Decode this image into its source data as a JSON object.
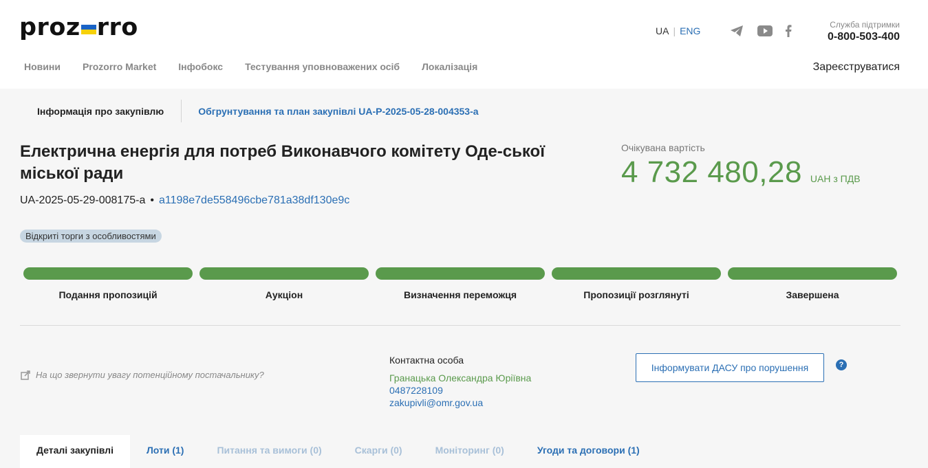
{
  "header": {
    "logo_left": "proz",
    "logo_right": "rro",
    "lang_ua": "UA",
    "lang_sep": "|",
    "lang_eng": "ENG",
    "support_label": "Служба підтримки",
    "support_phone": "0-800-503-400",
    "register": "Зареєструватися",
    "nav": [
      "Новини",
      "Prozorro Market",
      "Інфобокс",
      "Тестування уповноважених осіб",
      "Локалізація"
    ],
    "social_icons": [
      "telegram-icon",
      "youtube-icon",
      "facebook-icon"
    ]
  },
  "top_tabs": {
    "active": "Інформація про закупівлю",
    "plan_link": "Обгрунтування та план закупівлі UA-P-2025-05-28-004353-a"
  },
  "tender": {
    "title": "Електрична енергія для потреб Виконавчого комітету Оде-ської міської ради",
    "id": "UA-2025-05-29-008175-a",
    "dot": "•",
    "hash": "a1198e7de558496cbe781a38df130e9c",
    "procedure": "Відкриті торги з особливостями",
    "expected_label": "Очікувана вартість",
    "expected_value": "4 732 480,28",
    "expected_unit": "UAH з ПДВ"
  },
  "steps": [
    {
      "label": "Подання пропозицій",
      "complete": 1
    },
    {
      "label": "Аукціон",
      "complete": 1
    },
    {
      "label": "Визначення переможця",
      "complete": 1
    },
    {
      "label": "Пропозиції розглянуті",
      "complete": 1
    },
    {
      "label": "Завершена",
      "complete": 1
    }
  ],
  "hint": "На що звернути увагу потенційному постачальнику?",
  "contact": {
    "label": "Контактна особа",
    "name": "Гранацька Олександра Юріївна",
    "phone": "0487228109",
    "email": "zakupivli@omr.gov.ua"
  },
  "dasu_button": "Інформувати ДАСУ про порушення",
  "help": "?",
  "bottom_tabs": [
    {
      "label": "Деталі закупівлі",
      "state": "active"
    },
    {
      "label": "Лоти (1)",
      "state": "link"
    },
    {
      "label": "Питання та вимоги (0)",
      "state": "muted"
    },
    {
      "label": "Скарги (0)",
      "state": "muted"
    },
    {
      "label": "Моніторинг (0)",
      "state": "muted"
    },
    {
      "label": "Угоди та договори (1)",
      "state": "link"
    }
  ],
  "colors": {
    "accent_blue": "#2b6fb4",
    "green": "#5a9a4c",
    "flag_blue": "#1a63c6",
    "flag_yellow": "#f6d10a"
  }
}
